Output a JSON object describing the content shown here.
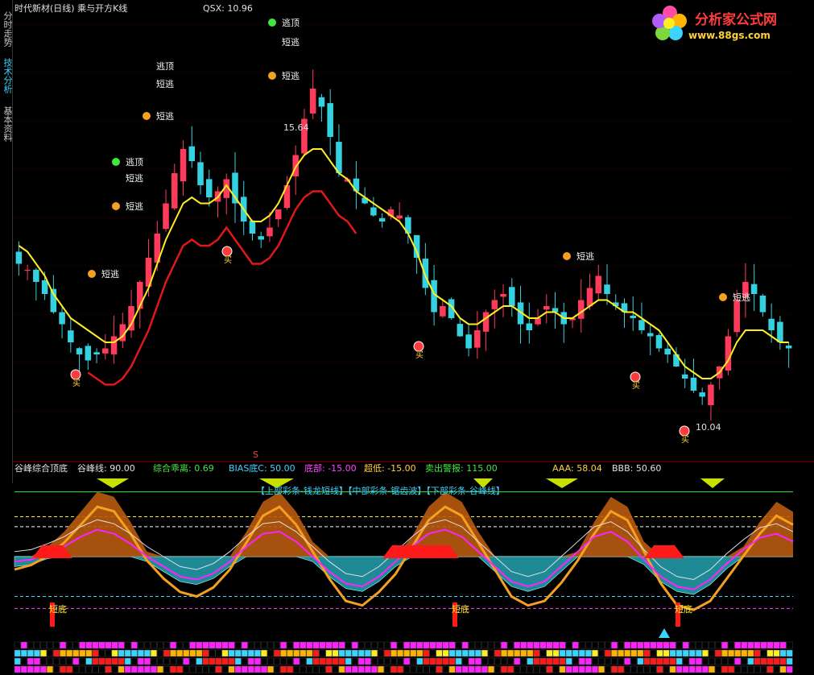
{
  "sidebar": {
    "tabs": [
      {
        "label": "分时走势",
        "active": false
      },
      {
        "label": "技术分析",
        "active": true
      },
      {
        "label": "基本资料",
        "active": false
      }
    ]
  },
  "main_panel": {
    "title": "时代新材(日线) 乘与开方K线",
    "qsx_label": "QSX: 10.96",
    "max_label": "15.64",
    "min_label": "10.04",
    "s_marker": "S"
  },
  "logo": {
    "title": "分析家公式网",
    "url": "www.88gs.com"
  },
  "annotations": {
    "escape_top": "逃顶",
    "short_escape": "短逃",
    "buy": "买"
  },
  "indicator_panel": {
    "title": "谷峰综合顶底",
    "values": [
      {
        "text": "谷峰线: 90.00",
        "color": "#e0e0e0"
      },
      {
        "text": "综合乖离: 0.69",
        "color": "#3ee83e"
      },
      {
        "text": "BIAS底C: 50.00",
        "color": "#3ad4ff"
      },
      {
        "text": "底部: -15.00",
        "color": "#ff44ff"
      },
      {
        "text": "超低: -15.00",
        "color": "#ffd13b"
      },
      {
        "text": "卖出警报: 115.00",
        "color": "#3ee83e"
      },
      {
        "text": "AAA: 58.04",
        "color": "#ffd13b"
      },
      {
        "text": "BBB: 50.60",
        "color": "#e0e0e0"
      }
    ],
    "legend": "【上部彩条-钱龙短线】【中部彩条-锯齿波】【下部彩条-谷峰线】",
    "bottom_label": "短底"
  },
  "colors": {
    "up": "#ff3b5c",
    "down": "#34d2e0",
    "ma_yellow": "#ffee22",
    "ma_red": "#e01818",
    "orange": "#f5a01e",
    "brown": "#b85a10",
    "teal": "#1f8a96",
    "magenta": "#ff22ff"
  },
  "chart_data": [
    {
      "type": "candlestick",
      "title": "时代新材(日线) 乘与开方K线",
      "y_range": [
        9.4,
        16.6
      ],
      "max_price": 15.64,
      "min_price": 10.04,
      "close_series": [
        12.5,
        12.4,
        12.2,
        12.0,
        11.7,
        11.5,
        11.2,
        11.0,
        10.9,
        11.0,
        11.1,
        11.3,
        11.5,
        11.8,
        12.2,
        12.6,
        13.0,
        13.5,
        14.0,
        14.4,
        14.2,
        13.8,
        13.6,
        13.7,
        13.9,
        13.5,
        13.2,
        13.0,
        12.9,
        13.1,
        13.4,
        13.8,
        14.3,
        14.9,
        15.4,
        15.1,
        14.6,
        14.0,
        13.9,
        13.7,
        13.5,
        13.3,
        13.2,
        13.4,
        13.3,
        13.0,
        12.6,
        12.1,
        11.7,
        11.8,
        11.6,
        11.3,
        11.1,
        11.4,
        11.7,
        11.9,
        12.0,
        11.8,
        11.5,
        11.4,
        11.6,
        11.8,
        11.7,
        11.5,
        11.6,
        11.9,
        12.1,
        12.3,
        12.0,
        11.8,
        11.7,
        11.6,
        11.4,
        11.3,
        11.1,
        11.0,
        10.8,
        10.6,
        10.4,
        10.3,
        10.5,
        10.8,
        11.3,
        11.9,
        12.2,
        12.0,
        11.7,
        11.4,
        11.2,
        11.1
      ],
      "ma_series": [
        12.8,
        12.7,
        12.5,
        12.3,
        12.0,
        11.8,
        11.6,
        11.5,
        11.4,
        11.3,
        11.2,
        11.2,
        11.3,
        11.5,
        11.8,
        12.1,
        12.5,
        12.9,
        13.2,
        13.5,
        13.6,
        13.5,
        13.5,
        13.6,
        13.8,
        13.6,
        13.4,
        13.2,
        13.2,
        13.3,
        13.5,
        13.8,
        14.1,
        14.3,
        14.4,
        14.4,
        14.2,
        14.0,
        13.9,
        13.7,
        13.6,
        13.5,
        13.4,
        13.3,
        13.2,
        13.0,
        12.7,
        12.3,
        12.0,
        11.9,
        11.8,
        11.6,
        11.5,
        11.5,
        11.6,
        11.7,
        11.8,
        11.8,
        11.7,
        11.6,
        11.6,
        11.7,
        11.7,
        11.6,
        11.6,
        11.7,
        11.8,
        11.9,
        11.9,
        11.8,
        11.7,
        11.7,
        11.6,
        11.5,
        11.4,
        11.2,
        11.0,
        10.8,
        10.7,
        10.6,
        10.6,
        10.7,
        10.9,
        11.2,
        11.4,
        11.4,
        11.4,
        11.3,
        11.2,
        11.2
      ]
    },
    {
      "type": "area",
      "title": "谷峰综合顶底",
      "y_range": [
        -30,
        130
      ],
      "reference_lines": {
        "sell_alert": 115,
        "upper": 90,
        "mid": 50,
        "bias_base": 50,
        "low": -15
      },
      "peak_valley_series": [
        30,
        35,
        45,
        60,
        80,
        100,
        95,
        70,
        40,
        20,
        5,
        0,
        10,
        30,
        60,
        90,
        100,
        80,
        50,
        20,
        -5,
        -10,
        5,
        25,
        55,
        85,
        100,
        90,
        60,
        30,
        0,
        -10,
        -5,
        15,
        40,
        70,
        95,
        85,
        50,
        15,
        -10,
        -15,
        -5,
        20,
        45,
        70,
        90,
        80
      ],
      "bias_series": [
        10,
        12,
        18,
        25,
        35,
        42,
        38,
        28,
        15,
        5,
        -5,
        -8,
        -2,
        10,
        25,
        38,
        40,
        30,
        15,
        0,
        -12,
        -15,
        -5,
        10,
        25,
        38,
        42,
        35,
        20,
        5,
        -10,
        -15,
        -10,
        5,
        20,
        35,
        40,
        30,
        12,
        -5,
        -15,
        -18,
        -8,
        8,
        22,
        34,
        38,
        30
      ]
    }
  ]
}
